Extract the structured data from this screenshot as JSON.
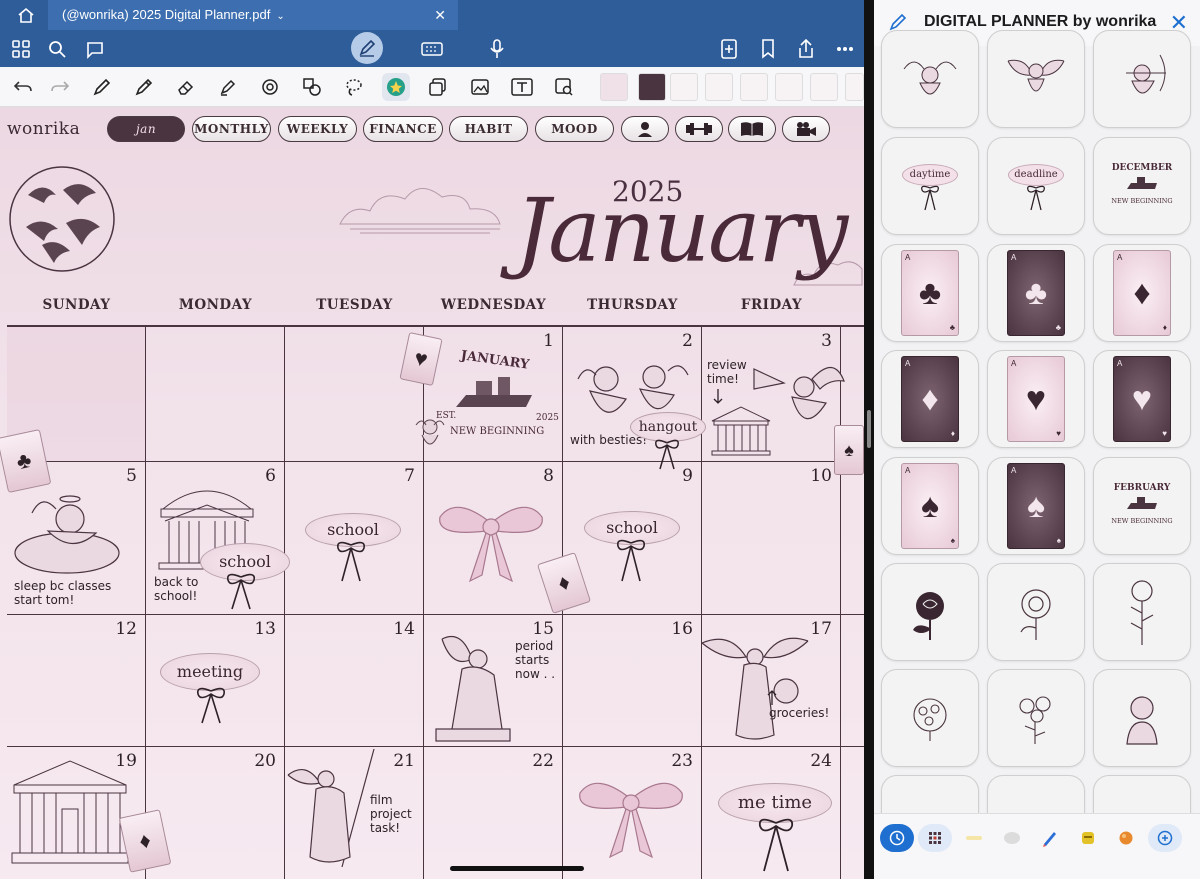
{
  "window": {
    "doc_tab_title": "(@wonrika) 2025 Digital Planner.pdf"
  },
  "planner": {
    "brand": "wonrika",
    "nav": [
      "jan",
      "MONTHLY",
      "WEEKLY",
      "FINANCE",
      "HABIT",
      "MOOD"
    ],
    "nav_icons": [
      "person-icon",
      "dumbbell-icon",
      "book-icon",
      "camera-icon"
    ],
    "year": "2025",
    "month": "January",
    "weekdays": [
      "SUNDAY",
      "MONDAY",
      "TUESDAY",
      "WEDNESDAY",
      "THURSDAY",
      "FRIDAY"
    ],
    "weeks": [
      [
        "",
        "",
        "",
        "1",
        "2",
        "3"
      ],
      [
        "5",
        "6",
        "7",
        "8",
        "9",
        "10"
      ],
      [
        "12",
        "13",
        "14",
        "15",
        "16",
        "17"
      ],
      [
        "19",
        "20",
        "21",
        "22",
        "23",
        "24"
      ]
    ],
    "notes": {
      "review": "review time!",
      "besties": "with besties!",
      "sleep": "sleep bc classes start tom!",
      "back_school": "back to school!",
      "period": "period starts now . .",
      "groceries": "groceries!",
      "film": "film project task!"
    },
    "labels": {
      "hangout": "hangout",
      "school": "school",
      "meeting": "meeting",
      "me_time": "me time"
    },
    "sticker_jan": {
      "title": "JANUARY",
      "est": "EST.",
      "year": "2025",
      "subtitle": "NEW BEGINNING"
    }
  },
  "panel": {
    "title": "DIGITAL PLANNER by wonrika",
    "stickers": {
      "daytime": "daytime",
      "deadline": "deadline",
      "december": "DECEMBER",
      "feb": "FEBRUARY",
      "nb": "NEW BEGINNING"
    }
  },
  "colors": {
    "toolbar_blue": "#2f5d9a",
    "accent_plum": "#4a3440",
    "planner_pink": "#f2e2ea",
    "ios_blue": "#1f6fd0"
  }
}
